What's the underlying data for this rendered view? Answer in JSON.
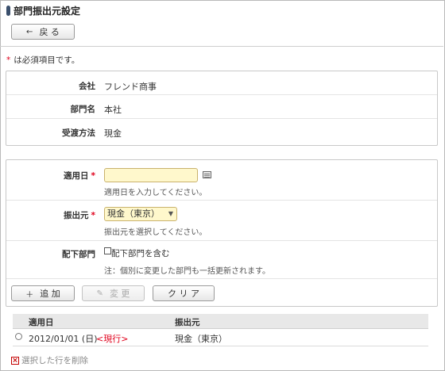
{
  "page": {
    "title": "部門振出元設定",
    "back_button": "戻 る"
  },
  "required_note": {
    "star": "*",
    "text": "は必須項目です。"
  },
  "info": {
    "company": {
      "label": "会社",
      "value": "フレンド商事"
    },
    "department": {
      "label": "部門名",
      "value": "本社"
    },
    "transfer_method": {
      "label": "受渡方法",
      "value": "現金"
    }
  },
  "form": {
    "effective_date": {
      "label": "適用日",
      "required": "*",
      "value": "",
      "help": "適用日を入力してください。"
    },
    "issuer": {
      "label": "振出元",
      "required": "*",
      "selected": "現金（東京）",
      "help": "振出元を選択してください。"
    },
    "subordinate": {
      "label": "配下部門",
      "checkbox_label": "配下部門を含む",
      "checked": false,
      "note": "注：個別に変更した部門も一括更新されます。"
    }
  },
  "actions": {
    "add": "追 加",
    "change": "変 更",
    "clear": "ク リ ア"
  },
  "list": {
    "headers": [
      "適用日",
      "振出元"
    ],
    "rows": [
      {
        "date": "2012/01/01 (日)",
        "status": "<現行>",
        "issuer": "現金（東京）"
      }
    ]
  },
  "delete_selected": "選択した行を削除",
  "colors": {
    "required": "#e0001b",
    "input_bg": "#fff8cc",
    "title_mark": "#3a4f6c"
  }
}
